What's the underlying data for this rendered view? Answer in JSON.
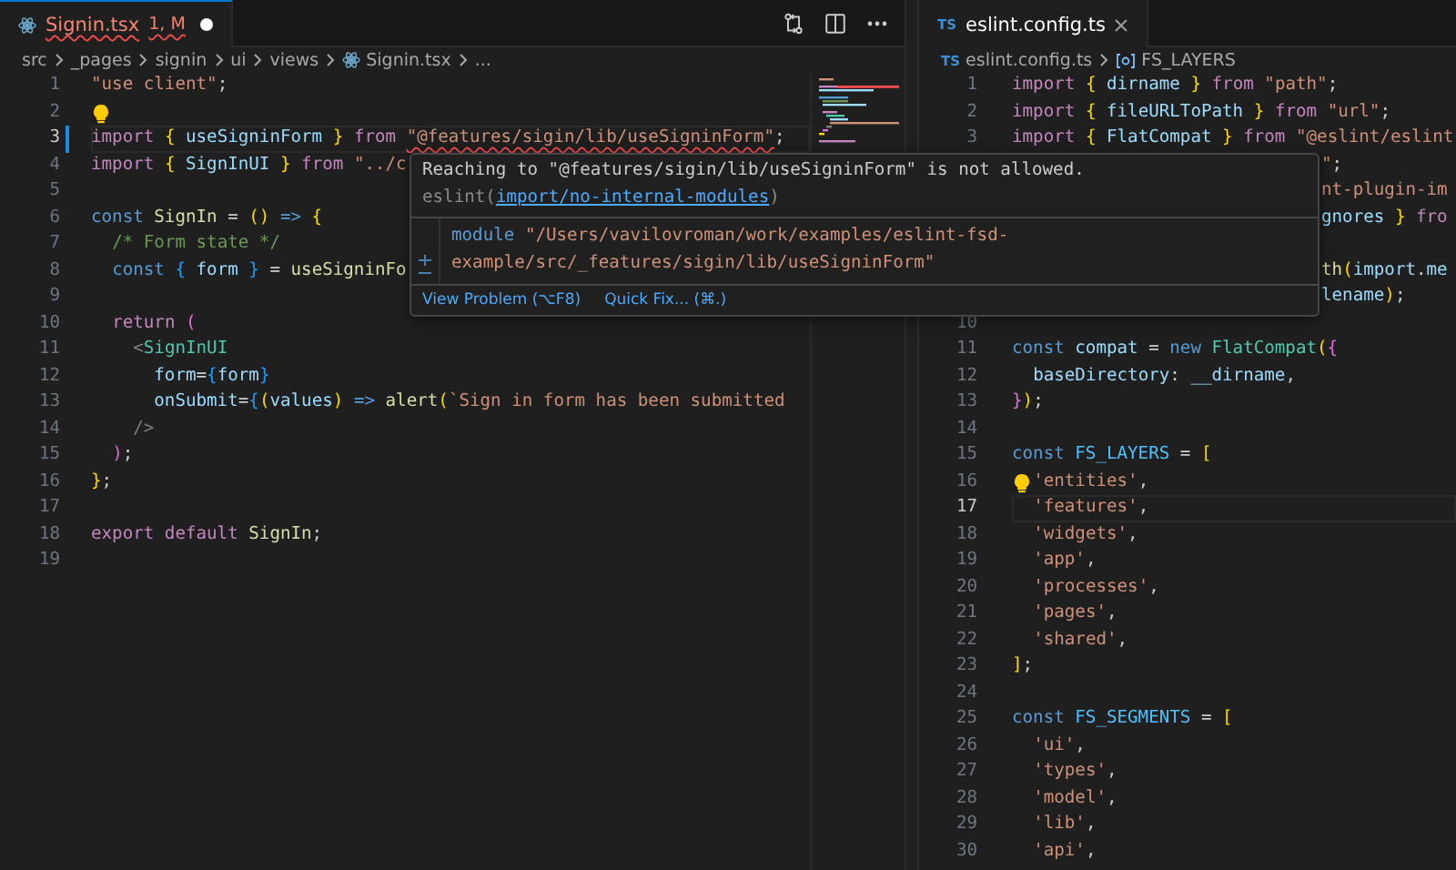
{
  "editors": [
    {
      "focused": true,
      "tab": {
        "label": "Signin.tsx",
        "status": "1, M",
        "selected": true,
        "dirty": true,
        "error": true
      },
      "breadcrumb": [
        {
          "kind": "folder",
          "text": "src"
        },
        {
          "kind": "folder",
          "text": "_pages"
        },
        {
          "kind": "folder",
          "text": "signin"
        },
        {
          "kind": "folder",
          "text": "ui"
        },
        {
          "kind": "folder",
          "text": "views"
        },
        {
          "kind": "file",
          "text": "Signin.tsx"
        },
        {
          "kind": "more",
          "text": "..."
        }
      ],
      "lines": [
        {
          "n": "1",
          "current": false,
          "modified": false,
          "bulb": false,
          "tokens": [
            {
              "kind": "string",
              "text": "\"use client\""
            },
            {
              "kind": "punct",
              "text": ";"
            }
          ]
        },
        {
          "n": "2",
          "current": false,
          "modified": false,
          "bulb": true
        },
        {
          "n": "3",
          "current": true,
          "modified": true,
          "bulb": false,
          "tokens": [
            {
              "kind": "keyword",
              "text": "import "
            },
            {
              "kind": "bracket-1",
              "text": "{ "
            },
            {
              "kind": "variable",
              "text": "useSigninForm "
            },
            {
              "kind": "bracket-1",
              "text": "} "
            },
            {
              "kind": "keyword",
              "text": "from "
            },
            {
              "kind": "string-error",
              "text": "\"@features/sigin/lib/useSigninForm\""
            },
            {
              "kind": "punct",
              "text": ";"
            }
          ]
        },
        {
          "n": "4",
          "current": false,
          "modified": false,
          "bulb": false,
          "tokens": [
            {
              "kind": "keyword",
              "text": "import "
            },
            {
              "kind": "bracket-1",
              "text": "{ "
            },
            {
              "kind": "variable",
              "text": "SignInUI "
            },
            {
              "kind": "bracket-1",
              "text": "} "
            },
            {
              "kind": "keyword",
              "text": "from "
            },
            {
              "kind": "string",
              "text": "\"../c"
            }
          ]
        },
        {
          "n": "5",
          "current": false,
          "modified": false,
          "bulb": false
        },
        {
          "n": "6",
          "current": false,
          "modified": false,
          "bulb": false,
          "tokens": [
            {
              "kind": "storage",
              "text": "const "
            },
            {
              "kind": "function",
              "text": "SignIn"
            },
            {
              "kind": "punct",
              "text": " = "
            },
            {
              "kind": "bracket-1",
              "text": "() "
            },
            {
              "kind": "storage",
              "text": "=> "
            },
            {
              "kind": "bracket-1",
              "text": "{"
            }
          ]
        },
        {
          "n": "7",
          "current": false,
          "modified": false,
          "bulb": false,
          "tokens": [
            {
              "kind": "comment",
              "text": "  /* Form state */"
            }
          ]
        },
        {
          "n": "8",
          "current": false,
          "modified": false,
          "bulb": false,
          "tokens": [
            {
              "kind": "storage",
              "text": "  const "
            },
            {
              "kind": "bracket-3",
              "text": "{ "
            },
            {
              "kind": "variable",
              "text": "form "
            },
            {
              "kind": "bracket-3",
              "text": "}"
            },
            {
              "kind": "punct",
              "text": " = "
            },
            {
              "kind": "function",
              "text": "useSigninFo"
            }
          ]
        },
        {
          "n": "9",
          "current": false,
          "modified": false,
          "bulb": false
        },
        {
          "n": "10",
          "current": false,
          "modified": false,
          "bulb": false,
          "tokens": [
            {
              "kind": "keyword",
              "text": "  return "
            },
            {
              "kind": "bracket-2",
              "text": "("
            }
          ]
        },
        {
          "n": "11",
          "current": false,
          "modified": false,
          "bulb": false,
          "tokens": [
            {
              "kind": "tag-punct",
              "text": "    <"
            },
            {
              "kind": "tag",
              "text": "SignInUI"
            }
          ]
        },
        {
          "n": "12",
          "current": false,
          "modified": false,
          "bulb": false,
          "tokens": [
            {
              "kind": "variable",
              "text": "      form"
            },
            {
              "kind": "punct",
              "text": "="
            },
            {
              "kind": "bracket-3",
              "text": "{"
            },
            {
              "kind": "variable",
              "text": "form"
            },
            {
              "kind": "bracket-3",
              "text": "}"
            }
          ]
        },
        {
          "n": "13",
          "current": false,
          "modified": false,
          "bulb": false,
          "tokens": [
            {
              "kind": "variable",
              "text": "      onSubmit"
            },
            {
              "kind": "punct",
              "text": "="
            },
            {
              "kind": "bracket-3",
              "text": "{"
            },
            {
              "kind": "bracket-1",
              "text": "("
            },
            {
              "kind": "variable",
              "text": "values"
            },
            {
              "kind": "bracket-1",
              "text": ") "
            },
            {
              "kind": "storage",
              "text": "=> "
            },
            {
              "kind": "function",
              "text": "alert"
            },
            {
              "kind": "bracket-1",
              "text": "("
            },
            {
              "kind": "string",
              "text": "`Sign in form has been submitted"
            }
          ]
        },
        {
          "n": "14",
          "current": false,
          "modified": false,
          "bulb": false,
          "tokens": [
            {
              "kind": "tag-punct",
              "text": "    />"
            }
          ]
        },
        {
          "n": "15",
          "current": false,
          "modified": false,
          "bulb": false,
          "tokens": [
            {
              "kind": "bracket-2",
              "text": "  )"
            },
            {
              "kind": "punct",
              "text": ";"
            }
          ]
        },
        {
          "n": "16",
          "current": false,
          "modified": false,
          "bulb": false,
          "tokens": [
            {
              "kind": "bracket-1",
              "text": "}"
            },
            {
              "kind": "punct",
              "text": ";"
            }
          ]
        },
        {
          "n": "17",
          "current": false,
          "modified": false,
          "bulb": false
        },
        {
          "n": "18",
          "current": false,
          "modified": false,
          "bulb": false,
          "tokens": [
            {
              "kind": "keyword",
              "text": "export default "
            },
            {
              "kind": "function",
              "text": "SignIn"
            },
            {
              "kind": "punct",
              "text": ";"
            }
          ]
        },
        {
          "n": "19",
          "current": false,
          "modified": false,
          "bulb": false
        }
      ]
    },
    {
      "focused": false,
      "tab": {
        "badge": "TS",
        "label": "eslint.config.ts",
        "selected": true,
        "dirty": false,
        "error": false
      },
      "breadcrumb": [
        {
          "kind": "file",
          "badge": "TS",
          "text": "eslint.config.ts"
        },
        {
          "kind": "symbol",
          "text": "FS_LAYERS"
        }
      ],
      "lines": [
        {
          "n": "1",
          "current": false,
          "modified": false,
          "bulb": false,
          "tokens": [
            {
              "kind": "keyword",
              "text": "import "
            },
            {
              "kind": "bracket-1",
              "text": "{ "
            },
            {
              "kind": "variable",
              "text": "dirname "
            },
            {
              "kind": "bracket-1",
              "text": "} "
            },
            {
              "kind": "keyword",
              "text": "from "
            },
            {
              "kind": "string",
              "text": "\"path\""
            },
            {
              "kind": "punct",
              "text": ";"
            }
          ]
        },
        {
          "n": "2",
          "current": false,
          "modified": false,
          "bulb": false,
          "tokens": [
            {
              "kind": "keyword",
              "text": "import "
            },
            {
              "kind": "bracket-1",
              "text": "{ "
            },
            {
              "kind": "variable",
              "text": "fileURLToPath "
            },
            {
              "kind": "bracket-1",
              "text": "} "
            },
            {
              "kind": "keyword",
              "text": "from "
            },
            {
              "kind": "string",
              "text": "\"url\""
            },
            {
              "kind": "punct",
              "text": ";"
            }
          ]
        },
        {
          "n": "3",
          "current": false,
          "modified": false,
          "bulb": false,
          "tokens": [
            {
              "kind": "keyword",
              "text": "import "
            },
            {
              "kind": "bracket-1",
              "text": "{ "
            },
            {
              "kind": "variable",
              "text": "FlatCompat "
            },
            {
              "kind": "bracket-1",
              "text": "} "
            },
            {
              "kind": "keyword",
              "text": "from "
            },
            {
              "kind": "string",
              "text": "\"@eslint/eslint"
            }
          ]
        },
        {
          "clipped": true,
          "current": false,
          "modified": false,
          "bulb": false,
          "tokens": [
            {
              "kind": "string",
              "text": "\""
            },
            {
              "kind": "punct",
              "text": ";"
            }
          ]
        },
        {
          "clipped": true,
          "current": false,
          "modified": false,
          "bulb": false,
          "tokens": [
            {
              "kind": "string",
              "text": "nt-plugin-im"
            }
          ]
        },
        {
          "clipped": true,
          "current": false,
          "modified": false,
          "bulb": false,
          "tokens": [
            {
              "kind": "variable",
              "text": "gnores "
            },
            {
              "kind": "bracket-1",
              "text": "} "
            },
            {
              "kind": "keyword",
              "text": "fro"
            }
          ]
        },
        {
          "clipped": true,
          "current": false,
          "modified": false,
          "bulb": false
        },
        {
          "clipped": true,
          "current": false,
          "modified": false,
          "bulb": false,
          "tokens": [
            {
              "kind": "function",
              "text": "th"
            },
            {
              "kind": "bracket-1",
              "text": "("
            },
            {
              "kind": "variable",
              "text": "import"
            },
            {
              "kind": "punct",
              "text": "."
            },
            {
              "kind": "variable",
              "text": "me"
            }
          ]
        },
        {
          "clipped": true,
          "current": false,
          "modified": false,
          "bulb": false,
          "tokens": [
            {
              "kind": "variable",
              "text": "lename"
            },
            {
              "kind": "bracket-1",
              "text": ")"
            },
            {
              "kind": "punct",
              "text": ";"
            }
          ]
        },
        {
          "n": "10",
          "current": false,
          "modified": false,
          "bulb": false
        },
        {
          "n": "11",
          "current": false,
          "modified": false,
          "bulb": false,
          "tokens": [
            {
              "kind": "storage",
              "text": "const "
            },
            {
              "kind": "variable",
              "text": "compat"
            },
            {
              "kind": "punct",
              "text": " = "
            },
            {
              "kind": "storage",
              "text": "new "
            },
            {
              "kind": "class",
              "text": "FlatCompat"
            },
            {
              "kind": "bracket-1",
              "text": "("
            },
            {
              "kind": "bracket-2",
              "text": "{"
            }
          ]
        },
        {
          "n": "12",
          "current": false,
          "modified": false,
          "bulb": false,
          "tokens": [
            {
              "kind": "variable",
              "text": "  baseDirectory"
            },
            {
              "kind": "punct",
              "text": ": "
            },
            {
              "kind": "variable",
              "text": "__dirname"
            },
            {
              "kind": "punct",
              "text": ","
            }
          ]
        },
        {
          "n": "13",
          "current": false,
          "modified": false,
          "bulb": false,
          "tokens": [
            {
              "kind": "bracket-2",
              "text": "}"
            },
            {
              "kind": "bracket-1",
              "text": ")"
            },
            {
              "kind": "punct",
              "text": ";"
            }
          ]
        },
        {
          "n": "14",
          "current": false,
          "modified": false,
          "bulb": false
        },
        {
          "n": "15",
          "current": false,
          "modified": false,
          "bulb": false,
          "tokens": [
            {
              "kind": "storage",
              "text": "const "
            },
            {
              "kind": "constant",
              "text": "FS_LAYERS"
            },
            {
              "kind": "punct",
              "text": " = "
            },
            {
              "kind": "bracket-1",
              "text": "["
            }
          ]
        },
        {
          "n": "16",
          "current": false,
          "modified": false,
          "bulb": true,
          "tokens": [
            {
              "kind": "string",
              "text": "  'entities'"
            },
            {
              "kind": "punct",
              "text": ","
            }
          ]
        },
        {
          "n": "17",
          "current": true,
          "modified": false,
          "bulb": false,
          "tokens": [
            {
              "kind": "string",
              "text": "  'features'"
            },
            {
              "kind": "punct",
              "text": ","
            }
          ]
        },
        {
          "n": "18",
          "current": false,
          "modified": false,
          "bulb": false,
          "tokens": [
            {
              "kind": "string",
              "text": "  'widgets'"
            },
            {
              "kind": "punct",
              "text": ","
            }
          ]
        },
        {
          "n": "19",
          "current": false,
          "modified": false,
          "bulb": false,
          "tokens": [
            {
              "kind": "string",
              "text": "  'app'"
            },
            {
              "kind": "punct",
              "text": ","
            }
          ]
        },
        {
          "n": "20",
          "current": false,
          "modified": false,
          "bulb": false,
          "tokens": [
            {
              "kind": "string",
              "text": "  'processes'"
            },
            {
              "kind": "punct",
              "text": ","
            }
          ]
        },
        {
          "n": "21",
          "current": false,
          "modified": false,
          "bulb": false,
          "tokens": [
            {
              "kind": "string",
              "text": "  'pages'"
            },
            {
              "kind": "punct",
              "text": ","
            }
          ]
        },
        {
          "n": "22",
          "current": false,
          "modified": false,
          "bulb": false,
          "tokens": [
            {
              "kind": "string",
              "text": "  'shared'"
            },
            {
              "kind": "punct",
              "text": ","
            }
          ]
        },
        {
          "n": "23",
          "current": false,
          "modified": false,
          "bulb": false,
          "tokens": [
            {
              "kind": "bracket-1",
              "text": "]"
            },
            {
              "kind": "punct",
              "text": ";"
            }
          ]
        },
        {
          "n": "24",
          "current": false,
          "modified": false,
          "bulb": false
        },
        {
          "n": "25",
          "current": false,
          "modified": false,
          "bulb": false,
          "tokens": [
            {
              "kind": "storage",
              "text": "const "
            },
            {
              "kind": "constant",
              "text": "FS_SEGMENTS"
            },
            {
              "kind": "punct",
              "text": " = "
            },
            {
              "kind": "bracket-1",
              "text": "["
            }
          ]
        },
        {
          "n": "26",
          "current": false,
          "modified": false,
          "bulb": false,
          "tokens": [
            {
              "kind": "string",
              "text": "  'ui'"
            },
            {
              "kind": "punct",
              "text": ","
            }
          ]
        },
        {
          "n": "27",
          "current": false,
          "modified": false,
          "bulb": false,
          "tokens": [
            {
              "kind": "string",
              "text": "  'types'"
            },
            {
              "kind": "punct",
              "text": ","
            }
          ]
        },
        {
          "n": "28",
          "current": false,
          "modified": false,
          "bulb": false,
          "tokens": [
            {
              "kind": "string",
              "text": "  'model'"
            },
            {
              "kind": "punct",
              "text": ","
            }
          ]
        },
        {
          "n": "29",
          "current": false,
          "modified": false,
          "bulb": false,
          "tokens": [
            {
              "kind": "string",
              "text": "  'lib'"
            },
            {
              "kind": "punct",
              "text": ","
            }
          ]
        },
        {
          "n": "30",
          "current": false,
          "modified": false,
          "bulb": false,
          "tokens": [
            {
              "kind": "string",
              "text": "  'api'"
            },
            {
              "kind": "punct",
              "text": ","
            }
          ]
        }
      ]
    }
  ],
  "hover": {
    "message": "Reaching to \"@features/sigin/lib/useSigninForm\" is not allowed.",
    "source": "eslint(",
    "rule": "import/no-internal-modules",
    "source_end": ")",
    "module_keyword": "module",
    "module_path": "\"/Users/vavilovroman/work/examples/eslint-fsd-example/src/_features/sigin/lib/useSigninForm\"",
    "actions": [
      "View Problem (⌥F8)",
      "Quick Fix... (⌘.)"
    ]
  }
}
